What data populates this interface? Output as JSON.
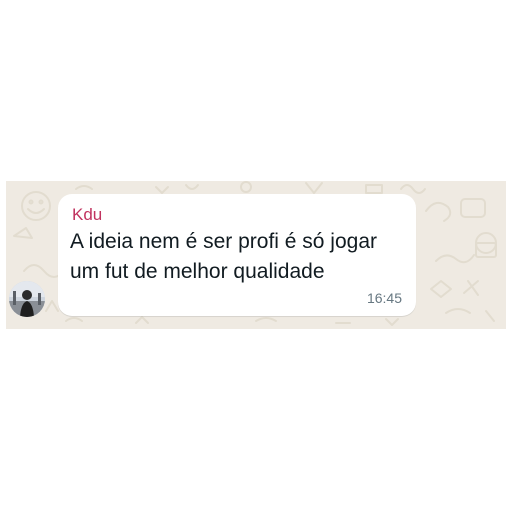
{
  "message": {
    "sender": "Kdu",
    "text": "A ideia nem é ser profi é só jogar um fut de melhor qualidade",
    "time": "16:45"
  },
  "colors": {
    "wallpaper": "#efeae2",
    "bubble": "#ffffff",
    "sender_name": "#c1335f",
    "message_text": "#111b21",
    "timestamp": "#667781"
  },
  "icons": [
    "avatar-photo"
  ]
}
